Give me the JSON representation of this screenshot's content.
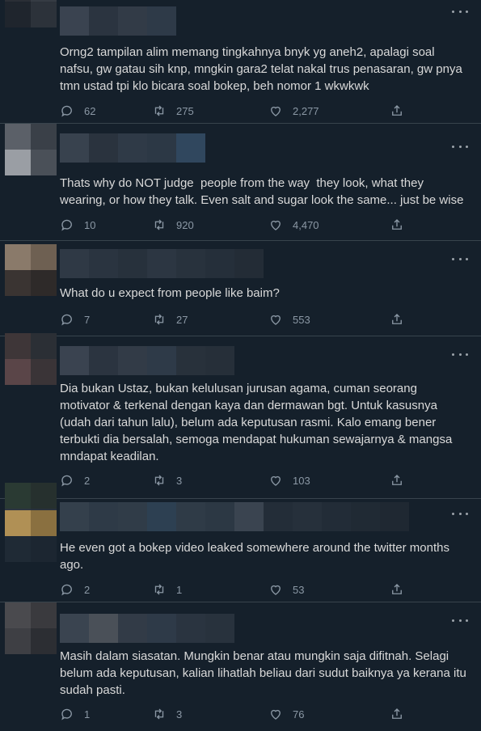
{
  "tweets": [
    {
      "text": "Orng2 tampilan alim memang tingkahnya bnyk yg aneh2, apalagi soal nafsu, gw gatau sih knp, mngkin gara2 telat nakal trus penasaran, gw pnya tmn ustad tpi klo bicara soal bokep, beh nomor 1 wkwkwk",
      "replies": "62",
      "retweets": "275",
      "likes": "2,277"
    },
    {
      "text": "Thats why do NOT judge  people from the way  they look, what they wearing, or how they talk. Even salt and sugar look the same... just be wise",
      "replies": "10",
      "retweets": "920",
      "likes": "4,470"
    },
    {
      "text": "What do u expect from people like baim?",
      "replies": "7",
      "retweets": "27",
      "likes": "553"
    },
    {
      "text": "Dia bukan Ustaz, bukan kelulusan jurusan agama, cuman seorang motivator & terkenal dengan kaya dan dermawan bgt. Untuk kasusnya (udah dari tahun lalu), belum ada keputusan rasmi. Kalo emang bener terbukti dia bersalah, semoga mendapat hukuman sewajarnya & mangsa mndapat keadilan.",
      "replies": "2",
      "retweets": "3",
      "likes": "103"
    },
    {
      "text": "He even got a bokep video leaked somewhere around the twitter months ago.",
      "replies": "2",
      "retweets": "1",
      "likes": "53"
    },
    {
      "text": "Masih dalam siasatan. Mungkin benar atau mungkin saja difitnah. Selagi belum ada keputusan, kalian lihatlah beliau dari sudut baiknya ya kerana itu sudah pasti.",
      "replies": "1",
      "retweets": "3",
      "likes": "76"
    }
  ],
  "icons": {
    "reply": "reply-icon",
    "retweet": "retweet-icon",
    "like": "like-icon",
    "share": "share-icon",
    "more": "more-options-icon"
  },
  "colors": {
    "background": "#15202b",
    "text": "#d9d9d9",
    "muted": "#8b98a5",
    "divider": "#38444d"
  }
}
